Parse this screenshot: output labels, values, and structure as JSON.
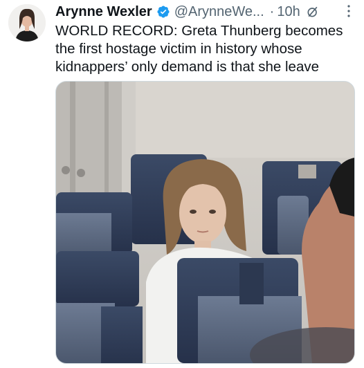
{
  "author": {
    "name": "Arynne Wexler",
    "handle": "@ArynneWe...",
    "time": "10h",
    "verified": true
  },
  "tweet": {
    "lines": [
      "WORLD RECORD: Greta Thunberg becomes",
      "the first hostage victim in history whose",
      "kidnappers’ only demand is that she leave"
    ]
  },
  "icons": {
    "verified": "verified-badge-icon",
    "grok": "grok-icon",
    "more": "more-icon"
  },
  "colors": {
    "verified_blue": "#1d9bf0",
    "secondary_text": "#536471",
    "primary_text": "#0f1419"
  }
}
